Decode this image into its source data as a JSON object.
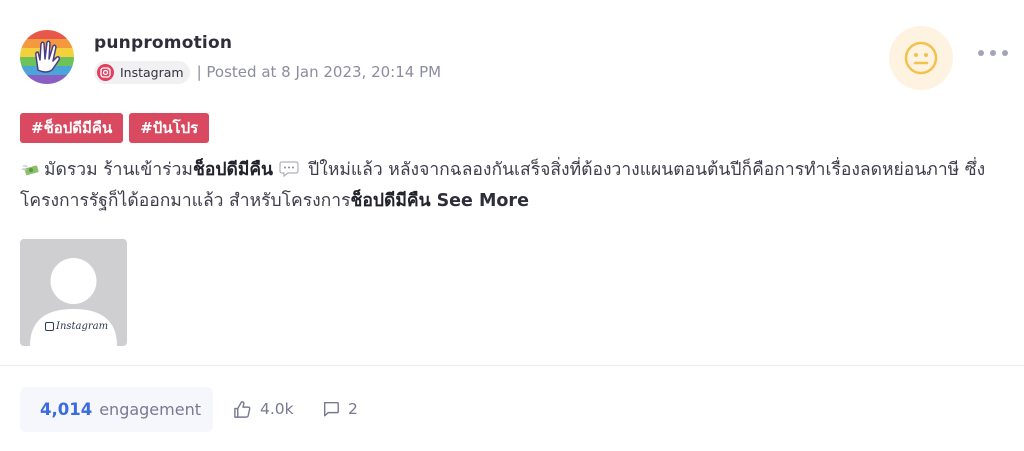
{
  "post": {
    "author": "punpromotion",
    "platform": "Instagram",
    "posted_at": "| Posted at 8 Jan 2023, 20:14 PM",
    "sentiment_icon": "neutral-face-icon",
    "tags": [
      "#ช็อปดีมีคืน",
      "#ปันโปร"
    ],
    "content": {
      "part1": "มัดรวม ร้านเข้าร่วม",
      "bold1": "ช็อปดีมีคืน",
      "part2": " ปีใหม่แล้ว หลังจากฉลองกันเสร็จสิ่งที่ต้องวางแผนตอนต้นปีก็คือการทำเรื่องลดหย่อนภาษี ซึ่งโครงการรัฐก็ได้ออกมาแล้ว สำหรับโครงการ",
      "bold2": "ช็อปดีมีคืน",
      "see_more": "See More"
    },
    "thumbnail_caption": "Instagram"
  },
  "stats": {
    "engagement_count": "4,014",
    "engagement_label": "engagement",
    "likes": "4.0k",
    "comments": "2"
  },
  "colors": {
    "tag_bg": "#d94a60",
    "accent_blue": "#3b6be0",
    "sentiment_bg": "#fdf3e0",
    "sentiment_face": "#f2c14e"
  }
}
